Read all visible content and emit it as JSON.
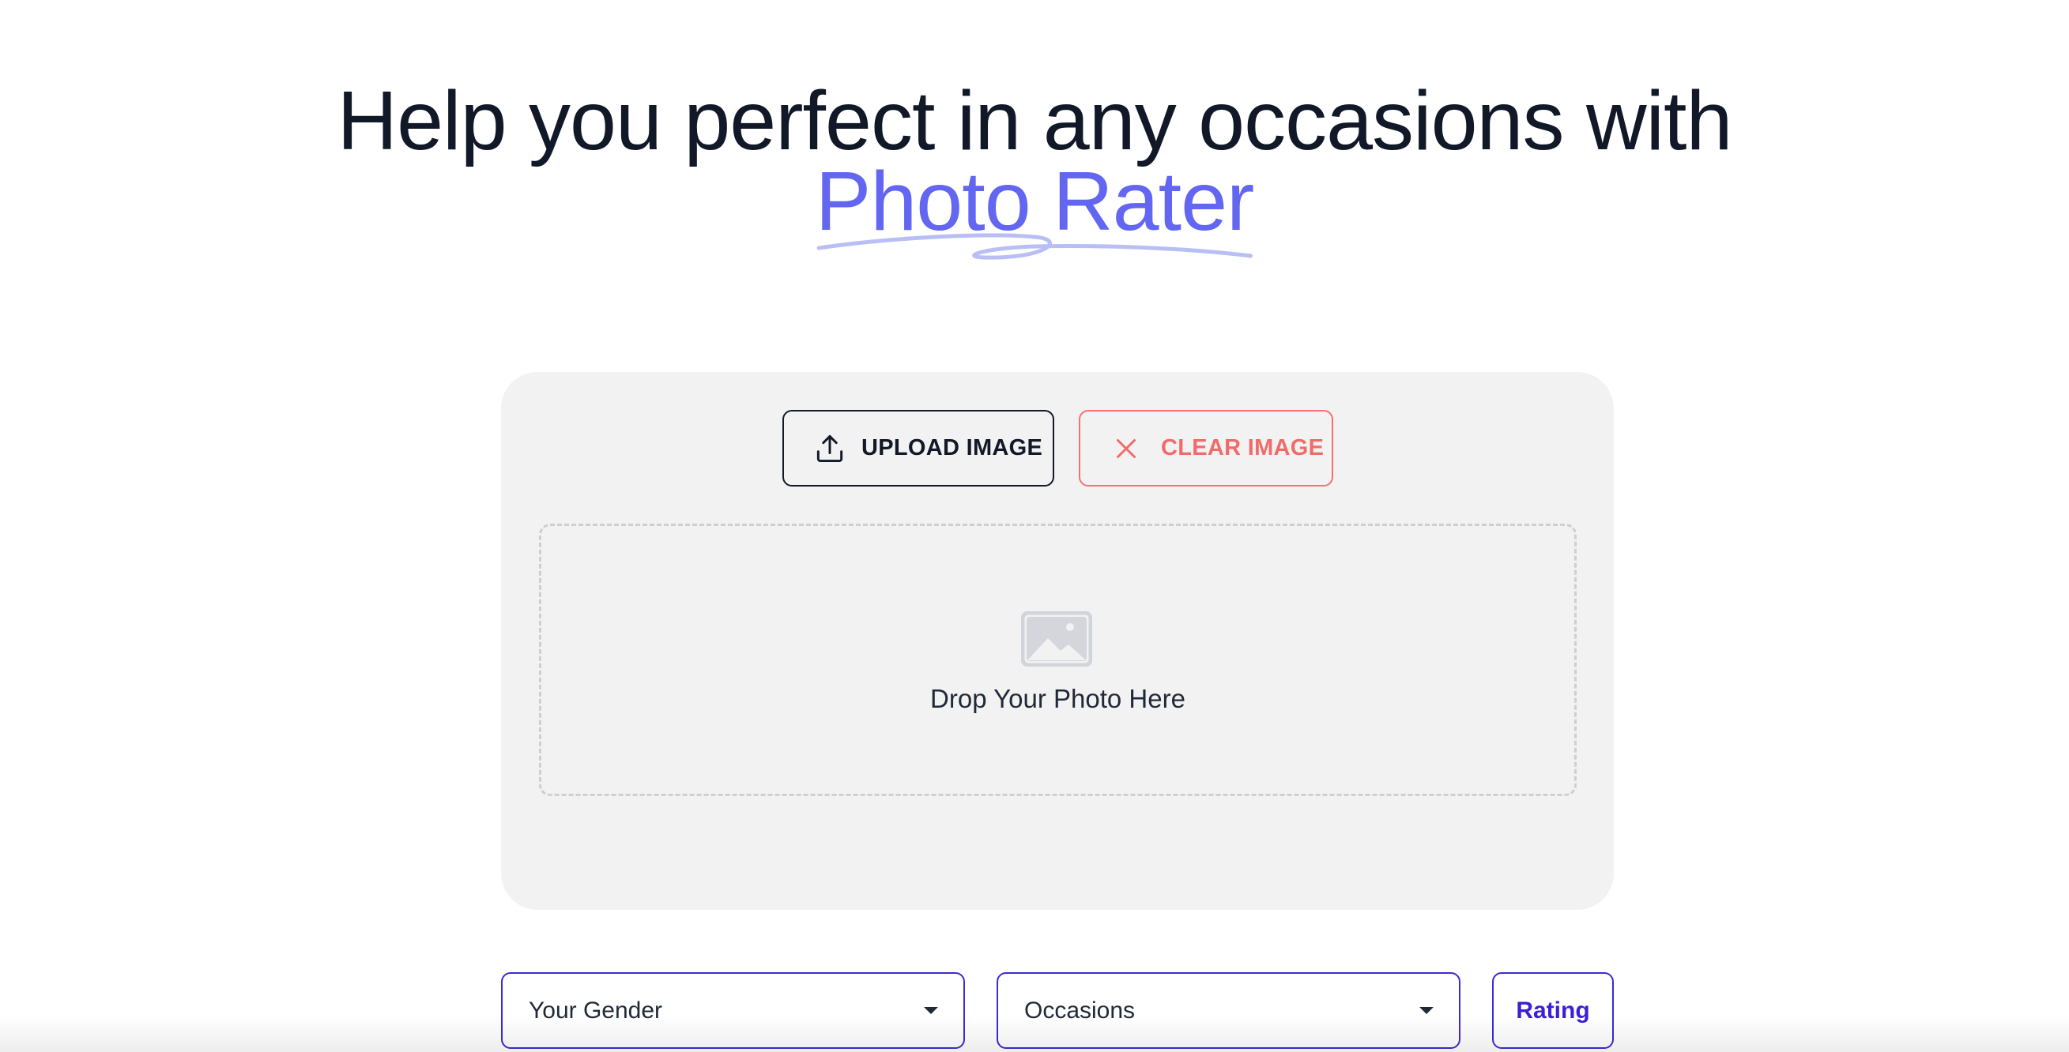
{
  "hero": {
    "line1": "Help you perfect in any occasions with",
    "line2": "Photo Rater",
    "accent_color": "#6366f1"
  },
  "upload_card": {
    "upload_button_label": "UPLOAD IMAGE",
    "upload_icon": "upload-icon",
    "clear_button_label": "CLEAR IMAGE",
    "clear_icon": "close-icon",
    "clear_color": "#f26b6b",
    "dropzone_icon": "image-icon",
    "dropzone_text": "Drop Your Photo Here"
  },
  "controls": {
    "gender_select": {
      "selected": "Your Gender"
    },
    "occasion_select": {
      "selected": "Occasions"
    },
    "rating_button_label": "Rating",
    "border_color": "#3b2ad6"
  }
}
